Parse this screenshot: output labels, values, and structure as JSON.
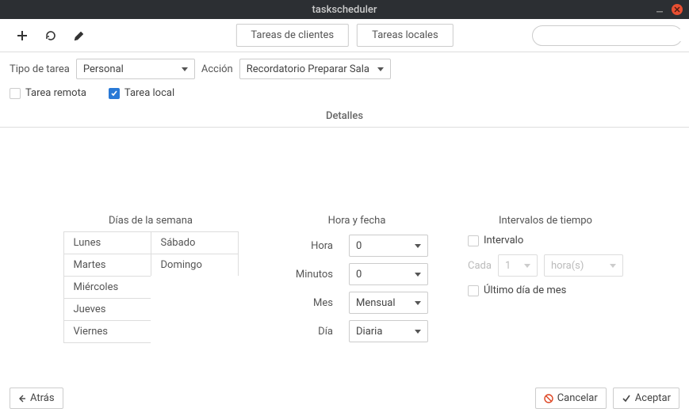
{
  "window": {
    "title": "taskscheduler"
  },
  "toolbar": {
    "tabs": {
      "clients": "Tareas de clientes",
      "local": "Tareas locales"
    },
    "search_placeholder": ""
  },
  "form": {
    "task_type_label": "Tipo de tarea",
    "task_type_value": "Personal",
    "action_label": "Acción",
    "action_value": "Recordatorio Preparar Sala",
    "remote_label": "Tarea remota",
    "remote_checked": false,
    "local_label": "Tarea local",
    "local_checked": true
  },
  "section": {
    "details_header": "Detalles"
  },
  "days": {
    "header": "Días de la semana",
    "items": [
      "Lunes",
      "Sábado",
      "Martes",
      "Domingo",
      "Miércoles",
      "",
      "Jueves",
      "",
      "Viernes",
      ""
    ]
  },
  "time": {
    "header": "Hora y fecha",
    "hour_label": "Hora",
    "hour_value": "0",
    "minute_label": "Minutos",
    "minute_value": "0",
    "month_label": "Mes",
    "month_value": "Mensual",
    "day_label": "Día",
    "day_value": "Diaria"
  },
  "interval": {
    "header": "Intervalos de tiempo",
    "interval_label": "Intervalo",
    "each_label": "Cada",
    "n_value": "1",
    "unit_value": "hora(s)",
    "lastday_label": "Último día de mes"
  },
  "footer": {
    "back_label": "Atrás",
    "cancel_label": "Cancelar",
    "accept_label": "Aceptar"
  }
}
